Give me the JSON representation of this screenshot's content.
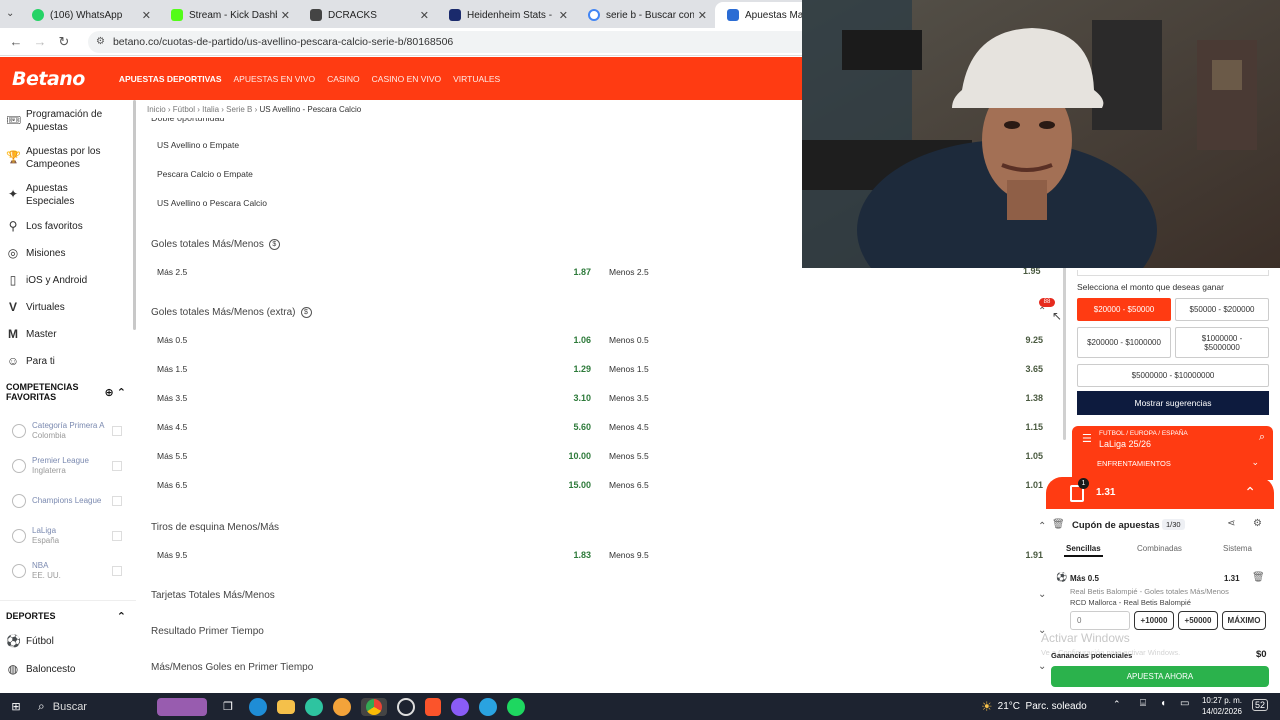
{
  "browser": {
    "tabs": [
      {
        "title": "(106) WhatsApp",
        "color": "#25d366"
      },
      {
        "title": "Stream - Kick Dashboard",
        "color": "#53fc18"
      },
      {
        "title": "DCRACKS",
        "color": "#444444"
      },
      {
        "title": "Heidenheim Stats - Shots",
        "color": "#1a2a6c"
      },
      {
        "title": "serie b - Buscar con Goog",
        "color": "#4285f4"
      },
      {
        "title": "Apuestas Mallorc",
        "color": "#2b6cd4"
      }
    ],
    "url": "betano.co/cuotas-de-partido/us-avellino-pescara-calcio-serie-b/80168506"
  },
  "header": {
    "logo": "Betano",
    "nav": [
      "APUESTAS DEPORTIVAS",
      "APUESTAS EN VIVO",
      "CASINO",
      "CASINO EN VIVO",
      "VIRTUALES"
    ]
  },
  "sidebar": {
    "items": [
      {
        "label": "Programación de Apuestas",
        "icon": "ticket-icon"
      },
      {
        "label": "Apuestas por los Campeones",
        "icon": "trophy-icon"
      },
      {
        "label": "Apuestas Especiales",
        "icon": "star-ticket-icon"
      },
      {
        "label": "Los favoritos",
        "icon": "pin-icon"
      },
      {
        "label": "Misiones",
        "icon": "target-icon"
      },
      {
        "label": "iOS y Android",
        "icon": "phone-icon"
      },
      {
        "label": "Virtuales",
        "icon": "v-icon"
      },
      {
        "label": "Master",
        "icon": "m-icon"
      },
      {
        "label": "Para ti",
        "icon": "user-icon"
      }
    ],
    "competitions_title": "COMPETENCIAS FAVORITAS",
    "favorites": [
      {
        "name": "Categoría Primera A",
        "region": "Colombia"
      },
      {
        "name": "Premier League",
        "region": "Inglaterra"
      },
      {
        "name": "Champions League",
        "region": ""
      },
      {
        "name": "LaLiga",
        "region": "España"
      },
      {
        "name": "NBA",
        "region": "EE. UU."
      }
    ],
    "sports_title": "DEPORTES",
    "sports": [
      {
        "label": "Fútbol",
        "icon": "soccer-ball-icon"
      },
      {
        "label": "Baloncesto",
        "icon": "basketball-icon"
      }
    ]
  },
  "breadcrumb": [
    "Inicio",
    "Fútbol",
    "Italia",
    "Serie B",
    "US Avellino - Pescara Calcio"
  ],
  "markets": {
    "double_chance": {
      "title": "Doble oportunidad",
      "rows": [
        "US Avellino o Empate",
        "Pescara Calcio o Empate",
        "US Avellino o Pescara Calcio"
      ]
    },
    "goals": {
      "title": "Goles totales Más/Menos",
      "rows": [
        {
          "over": "Más 2.5",
          "over_odd": "1.87",
          "under": "Menos 2.5",
          "under_odd": "1.95"
        }
      ]
    },
    "goals_extra": {
      "title": "Goles totales Más/Menos (extra)",
      "rows": [
        {
          "over": "Más 0.5",
          "over_odd": "1.06",
          "under": "Menos 0.5",
          "under_odd": "9.25"
        },
        {
          "over": "Más 1.5",
          "over_odd": "1.29",
          "under": "Menos 1.5",
          "under_odd": "3.65"
        },
        {
          "over": "Más 3.5",
          "over_odd": "3.10",
          "under": "Menos 3.5",
          "under_odd": "1.38"
        },
        {
          "over": "Más 4.5",
          "over_odd": "5.60",
          "under": "Menos 4.5",
          "under_odd": "1.15"
        },
        {
          "over": "Más 5.5",
          "over_odd": "10.00",
          "under": "Menos 5.5",
          "under_odd": "1.05"
        },
        {
          "over": "Más 6.5",
          "over_odd": "15.00",
          "under": "Menos 6.5",
          "under_odd": "1.01"
        }
      ]
    },
    "corners": {
      "title": "Tiros de esquina Menos/Más",
      "rows": [
        {
          "over": "Más 9.5",
          "over_odd": "1.83",
          "under": "Menos 9.5",
          "under_odd": "1.91"
        }
      ]
    },
    "collapsed": [
      "Tarjetas Totales Más/Menos",
      "Resultado Primer Tiempo",
      "Más/Menos Goles en Primer Tiempo"
    ]
  },
  "right_panel": {
    "select_label": "Selecciona el monto que deseas ganar",
    "amounts": [
      "$20000 - $50000",
      "$50000 - $200000",
      "$200000 - $1000000",
      "$1000000 - $5000000",
      "$5000000 - $10000000"
    ],
    "suggest_button": "Mostrar sugerencias",
    "league_path": "FUTBOL / EUROPA / ESPAÑA",
    "league_name": "LaLiga 25/26",
    "matchups": "ENFRENTAMIENTOS",
    "slip_count": "1",
    "slip_odds": "1.31",
    "slip_title": "Cupón de apuestas",
    "slip_pages": "1/30",
    "slip_tabs": [
      "Sencillas",
      "Combinadas",
      "Sistema"
    ],
    "bet": {
      "selection": "Más 0.5",
      "odds": "1.31",
      "market": "Real Betis Balompié - Goles totales Más/Menos",
      "match": "RCD Mallorca - Real Betis Balompié",
      "stake_placeholder": "0",
      "quick": [
        "+10000",
        "+50000",
        "MÁXIMO"
      ]
    },
    "windows_watermark": "Activar Windows",
    "windows_sub": "Ve a Configuración para activar Windows.",
    "potential_label": "Ganancias potenciales",
    "potential_value": "$0",
    "place_button": "APUESTA AHORA",
    "badge": "88"
  },
  "taskbar": {
    "search": "Buscar",
    "weather": "21°C  Parc. soleado",
    "time": "10:27 p. m.",
    "date": "14/02/2026",
    "notif": "52"
  }
}
